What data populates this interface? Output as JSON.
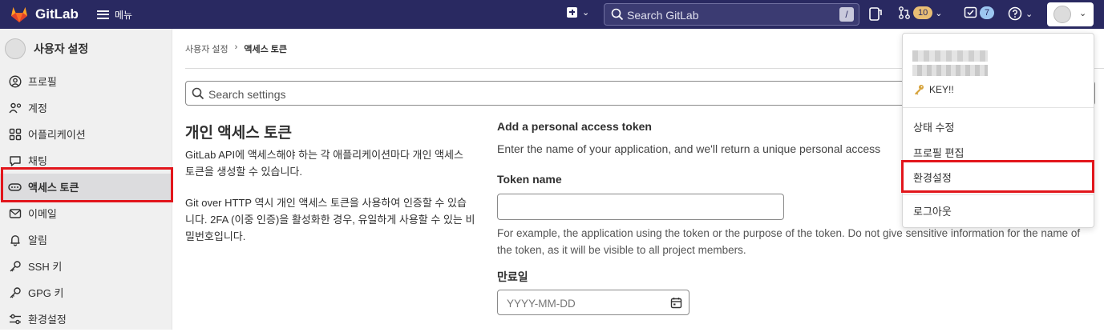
{
  "navbar": {
    "brand": "GitLab",
    "menu_label": "메뉴",
    "search_placeholder": "Search GitLab",
    "search_shortcut": "/",
    "merge_requests_count": "10",
    "todos_count": "7"
  },
  "sidebar": {
    "title": "사용자 설정",
    "items": [
      {
        "label": "프로필",
        "icon": "profile-icon"
      },
      {
        "label": "계정",
        "icon": "account-icon"
      },
      {
        "label": "어플리케이션",
        "icon": "applications-icon"
      },
      {
        "label": "채팅",
        "icon": "chat-icon"
      },
      {
        "label": "액세스 토큰",
        "icon": "token-icon",
        "active": true
      },
      {
        "label": "이메일",
        "icon": "email-icon"
      },
      {
        "label": "알림",
        "icon": "bell-icon"
      },
      {
        "label": "SSH 키",
        "icon": "key-icon"
      },
      {
        "label": "GPG 키",
        "icon": "key-icon"
      },
      {
        "label": "환경설정",
        "icon": "preferences-icon"
      }
    ]
  },
  "breadcrumb": {
    "parent": "사용자 설정",
    "separator": "›",
    "current": "액세스 토큰"
  },
  "search_settings": {
    "placeholder": "Search settings"
  },
  "intro": {
    "title": "개인 액세스 토큰",
    "desc1": "GitLab API에 액세스해야 하는 각 애플리케이션마다 개인 액세스 토큰을 생성할 수 있습니다.",
    "desc2": "Git over HTTP 역시 개인 액세스 토큰을 사용하여 인증할 수 있습니다. 2FA (이중 인증)을 활성화한 경우, 유일하게 사용할 수 있는 비밀번호입니다."
  },
  "form": {
    "title": "Add a personal access token",
    "intro": "Enter the name of your application, and we'll return a unique personal access",
    "token_name_label": "Token name",
    "token_name_value": "",
    "token_help": "For example, the application using the token or the purpose of the token. Do not give sensitive information for the name of the token, as it will be visible to all project members.",
    "expiry_label": "만료일",
    "expiry_placeholder": "YYYY-MM-DD"
  },
  "user_dropdown": {
    "status_text": "KEY!!",
    "items": [
      "상태 수정",
      "프로필 편집",
      "환경설정",
      "로그아웃"
    ]
  },
  "colors": {
    "navbar": "#292961",
    "highlight": "#e2161c",
    "sidebar_bg": "#f0f0f0"
  }
}
